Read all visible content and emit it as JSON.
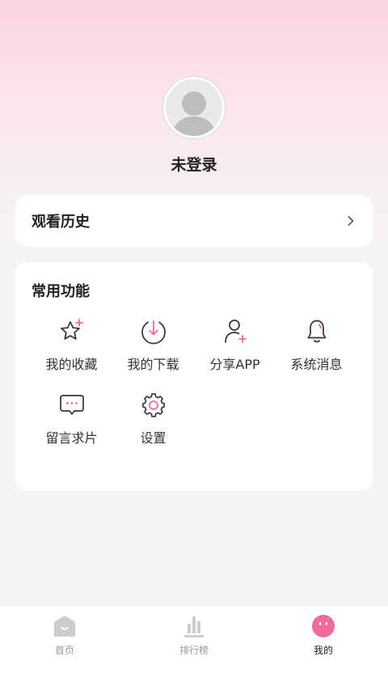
{
  "profile": {
    "username": "未登录",
    "avatar_icon": "default-avatar-icon"
  },
  "history": {
    "title": "观看历史",
    "icon": "chevron-right-icon"
  },
  "functions": {
    "title": "常用功能",
    "items": [
      {
        "label": "我的收藏",
        "icon": "star-plus-icon"
      },
      {
        "label": "我的下载",
        "icon": "download-icon"
      },
      {
        "label": "分享APP",
        "icon": "user-plus-icon"
      },
      {
        "label": "系统消息",
        "icon": "bell-icon"
      },
      {
        "label": "留言求片",
        "icon": "message-icon"
      },
      {
        "label": "设置",
        "icon": "gear-icon"
      }
    ]
  },
  "tabbar": {
    "items": [
      {
        "label": "首页",
        "icon": "home-icon",
        "active": false
      },
      {
        "label": "排行榜",
        "icon": "ranking-icon",
        "active": false
      },
      {
        "label": "我的",
        "icon": "mine-icon",
        "active": true
      }
    ]
  },
  "colors": {
    "accent": "#f06a9b",
    "icon_stroke": "#333333",
    "tab_inactive": "#cccccc"
  }
}
